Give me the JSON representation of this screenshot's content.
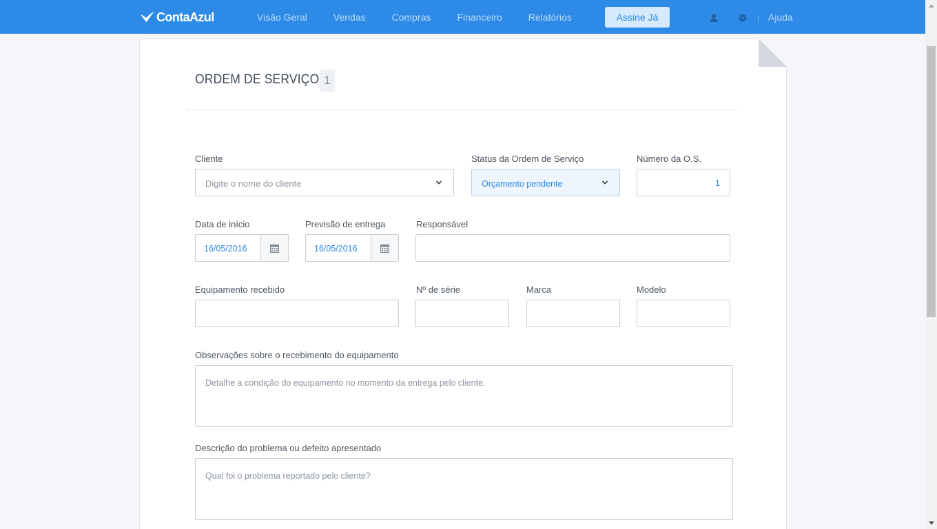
{
  "header": {
    "logo_text": "ContaAzul",
    "nav": [
      "Visão Geral",
      "Vendas",
      "Compras",
      "Financeiro",
      "Relatórios"
    ],
    "cta_label": "Assine Já",
    "help_label": "Ajuda",
    "icons": {
      "user": "user-icon",
      "settings": "gear-icon"
    },
    "brand_color": "#2d8ae6"
  },
  "page": {
    "title": "ORDEM DE SERVIÇO",
    "number_badge": "1"
  },
  "form": {
    "cliente": {
      "label": "Cliente",
      "placeholder": "Digite o nome do cliente"
    },
    "status": {
      "label": "Status da Ordem de Serviço",
      "value": "Orçamento pendente"
    },
    "numero": {
      "label": "Número da O.S.",
      "value": "1"
    },
    "data_inicio": {
      "label": "Data de início",
      "value": "16/05/2016"
    },
    "previsao": {
      "label": "Previsão de entrega",
      "value": "16/05/2016"
    },
    "responsavel": {
      "label": "Responsável",
      "value": ""
    },
    "equipamento": {
      "label": "Equipamento recebido",
      "value": ""
    },
    "serie": {
      "label": "Nº de série",
      "value": ""
    },
    "marca": {
      "label": "Marca",
      "value": ""
    },
    "modelo": {
      "label": "Modelo",
      "value": ""
    },
    "observacoes": {
      "label": "Observações sobre o recebimento do equipamento",
      "placeholder": "Detalhe a condição do equipamento no momento da entrega pelo cliente."
    },
    "descricao": {
      "label": "Descrição do problema ou defeito apresentado",
      "placeholder": "Qual foi o problema reportado pelo cliente?"
    }
  }
}
